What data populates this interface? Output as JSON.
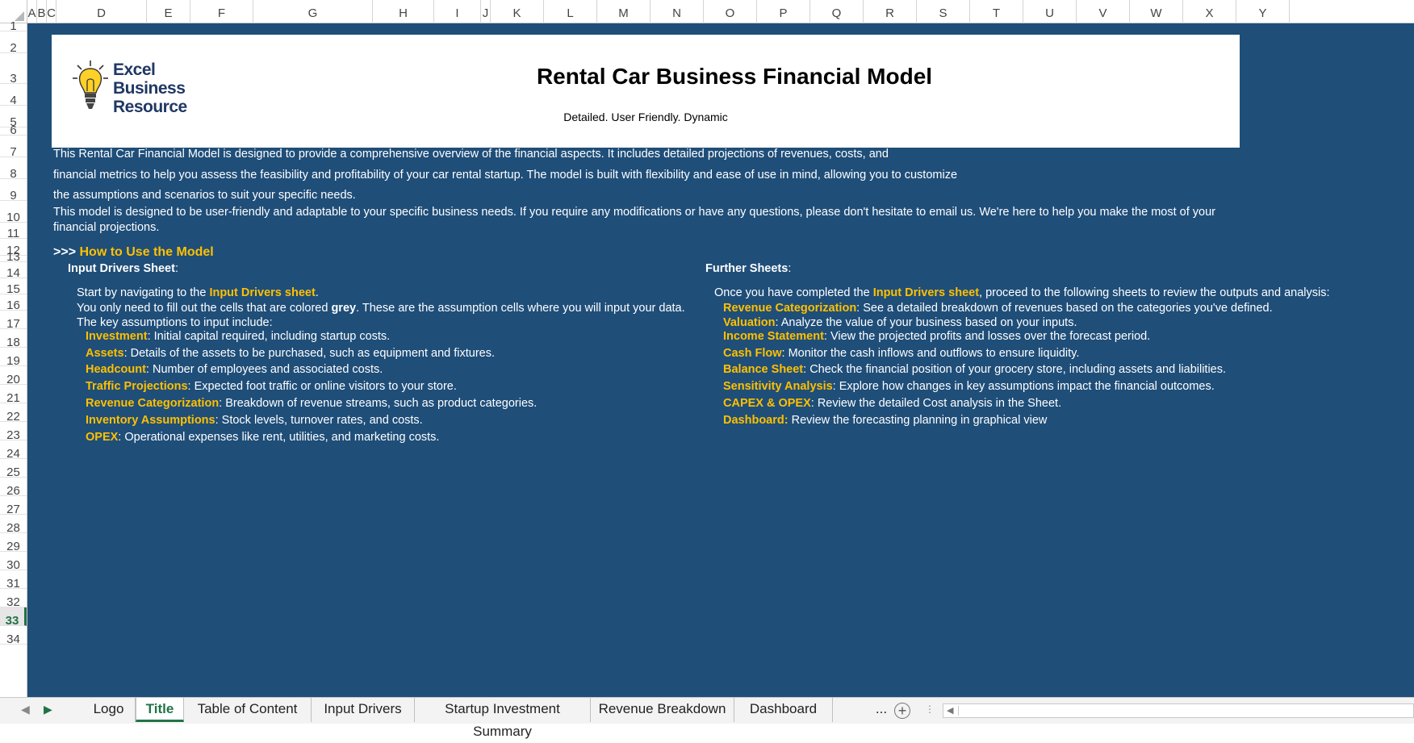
{
  "columns": [
    "A",
    "B",
    "C",
    "D",
    "E",
    "F",
    "G",
    "H",
    "I",
    "J",
    "K",
    "L",
    "M",
    "N",
    "O",
    "P",
    "Q",
    "R",
    "S",
    "T",
    "U",
    "V",
    "W",
    "X",
    "Y"
  ],
  "rows": [
    "1",
    "2",
    "3",
    "4",
    "5",
    "6",
    "7",
    "8",
    "9",
    "10",
    "11",
    "12",
    "13",
    "14",
    "15",
    "16",
    "17",
    "18",
    "19",
    "20",
    "21",
    "22",
    "23",
    "24",
    "25",
    "26",
    "27",
    "28",
    "29",
    "30",
    "31",
    "32",
    "33",
    "34"
  ],
  "active_row": "33",
  "logo": {
    "line1": "Excel",
    "line2": "Business",
    "line3": "Resource"
  },
  "header": {
    "title": "Rental Car Business Financial Model",
    "subtitle": "Detailed. User Friendly. Dynamic"
  },
  "intro": {
    "line1": "This Rental Car Financial Model is designed to provide a comprehensive overview of the financial aspects. It includes detailed projections of revenues, costs, and",
    "line2": "financial metrics to help you assess the feasibility and profitability of your car rental startup. The model is built with flexibility and ease of use in mind, allowing you to customize",
    "line3": "the assumptions and scenarios to suit your specific needs.",
    "line4": "This model is designed to be user-friendly and adaptable to your specific business needs. If you require any modifications or have any questions, please don't hesitate to email us. We're here to help you make the most of your",
    "line5": "financial projections."
  },
  "how_to": {
    "prefix": ">>> ",
    "title": "How to Use the Model"
  },
  "left": {
    "heading": "Input Drivers Sheet",
    "heading_suffix": ":",
    "start_pre": "Start by navigating to the ",
    "start_link": "Input Drivers sheet",
    "start_post": ".",
    "fill_pre": "You only need to fill out the cells that are colored ",
    "fill_bold": "grey",
    "fill_post": ". These are the assumption cells where you will input your data.",
    "key": "The key assumptions to input include:",
    "items": [
      {
        "label": "Investment",
        "text": ": Initial capital required, including startup costs."
      },
      {
        "label": "Assets",
        "text": ": Details of the assets to be purchased, such as equipment and fixtures."
      },
      {
        "label": "Headcount",
        "text": ": Number of employees and associated costs."
      },
      {
        "label": "Traffic Projections",
        "text": ": Expected foot traffic or online visitors to your store."
      },
      {
        "label": "Revenue Categorization",
        "text": ": Breakdown of revenue streams, such as product categories."
      },
      {
        "label": "Inventory Assumptions",
        "text": ": Stock levels, turnover rates, and costs."
      },
      {
        "label": "OPEX",
        "text": ": Operational expenses like rent, utilities, and marketing costs."
      }
    ]
  },
  "right": {
    "heading": "Further Sheets",
    "heading_suffix": ":",
    "once_pre": "Once you have completed the ",
    "once_link": "Input Drivers sheet",
    "once_post": ", proceed to the following sheets to review the outputs and analysis:",
    "items": [
      {
        "label": "Revenue Categorization",
        "text": ": See a detailed breakdown of revenues based on the categories you've defined."
      },
      {
        "label": "Valuation",
        "text": ": Analyze the value of your business based on your inputs."
      },
      {
        "label": "Income Statement",
        "text": ": View the projected profits and losses over the forecast period."
      },
      {
        "label": "Cash Flow",
        "text": ": Monitor the cash inflows and outflows to ensure liquidity."
      },
      {
        "label": "Balance Sheet",
        "text": ": Check the financial position of your grocery store, including assets and liabilities."
      },
      {
        "label": "Sensitivity Analysis",
        "text": ": Explore how changes in key assumptions impact the financial outcomes."
      },
      {
        "label": "CAPEX & OPEX",
        "text": ": Review the detailed Cost analysis in the Sheet."
      },
      {
        "label": "Dashboard:",
        "text": " Review the forecasting planning in graphical view"
      }
    ]
  },
  "tabs": {
    "items": [
      "Logo",
      "Title",
      "Table of Content",
      "Input Drivers",
      "Startup Investment Summary",
      "Revenue Breakdown",
      "Dashboard"
    ],
    "active": "Title",
    "more": "...",
    "add": "+"
  }
}
